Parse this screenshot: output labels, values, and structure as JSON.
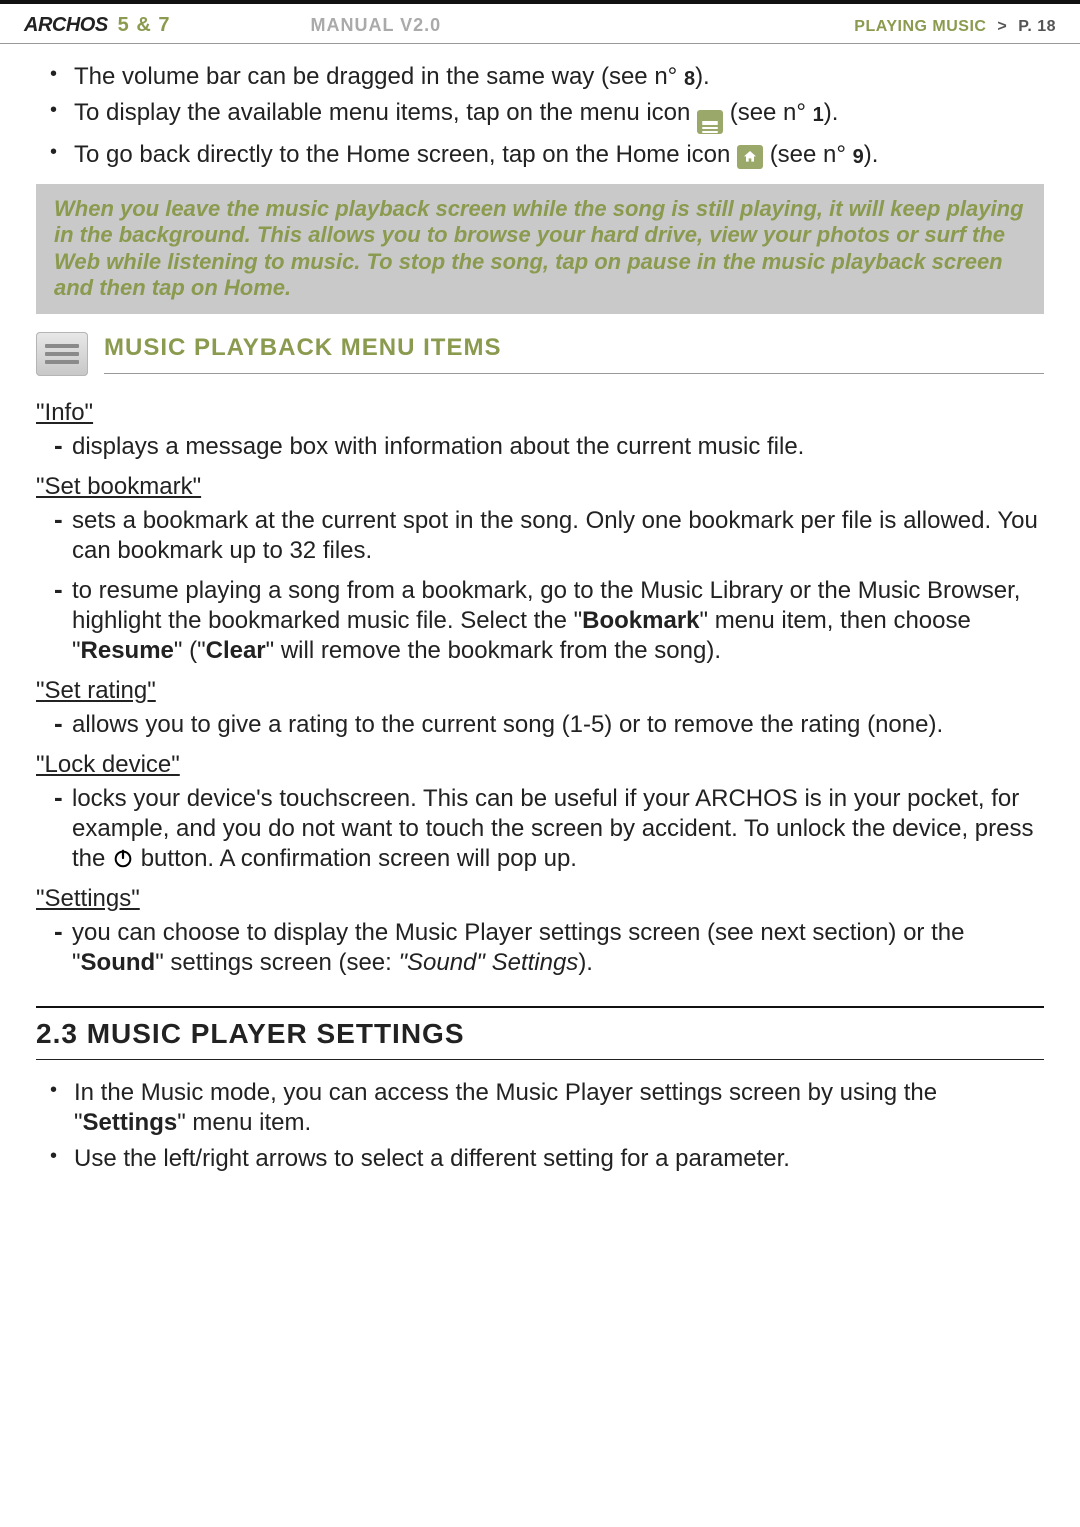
{
  "header": {
    "brand": "ARCHOS",
    "model": "5 & 7",
    "manual": "MANUAL V2.0",
    "section": "PLAYING MUSIC",
    "gt": ">",
    "page": "P. 18"
  },
  "intro_bullets": [
    {
      "pre": "The volume bar can be dragged in the same way (see n° ",
      "ref": "8",
      "post": ")."
    },
    {
      "pre": "To display the available menu items, tap on the menu icon ",
      "icon": "menu",
      "mid": " (see n° ",
      "ref": "1",
      "post": ")."
    },
    {
      "pre": "To go back directly to the Home screen, tap on the Home icon ",
      "icon": "home",
      "mid": " (see n° ",
      "ref": "9",
      "post": ")."
    }
  ],
  "note": "When you leave the music playback screen while the song is still playing, it will keep playing in the background. This allows you to browse your hard drive, view your photos or surf the Web while listening to music. To stop the song, tap on pause in the music playback screen and then tap on Home.",
  "section_menu_title": "MUSIC PLAYBACK MENU ITEMS",
  "menu_items": {
    "info": {
      "title": "\"Info\"",
      "lines": [
        {
          "text": "displays a message box with information about the current music file."
        }
      ]
    },
    "set_bookmark": {
      "title": "\"Set bookmark\"",
      "lines": [
        {
          "text": "sets a bookmark at the current spot in the song. Only one bookmark per file is allowed. You can bookmark up to 32 files."
        },
        {
          "pre": "to resume playing a song from a bookmark, go to the Music Library or the Music Browser, highlight the bookmarked music file. Select the \"",
          "b1": "Bookmark",
          "mid1": "\" menu item, then choose \"",
          "b2": "Resume",
          "mid2": "\" (\"",
          "b3": "Clear",
          "post": "\" will remove the bookmark from the song)."
        }
      ]
    },
    "set_rating": {
      "title": "\"Set rating\"",
      "lines": [
        {
          "text": "allows you to give a rating to the current song (1-5) or to remove the rating (none)."
        }
      ]
    },
    "lock_device": {
      "title": "\"Lock device\"",
      "lines": [
        {
          "pre": "locks your device's touchscreen. This can be useful if your ARCHOS is in your pocket, for example, and you do not want to touch the screen by accident. To unlock the device, press the ",
          "icon": "power",
          "post": " button. A confirmation screen will pop up."
        }
      ]
    },
    "settings": {
      "title": "\"Settings\"",
      "lines": [
        {
          "pre": "you can choose to display the Music Player settings screen (see next section) or the \"",
          "b1": "Sound",
          "mid1": "\" settings screen (see: ",
          "i1": "\"Sound\" Settings",
          "post": ")."
        }
      ]
    }
  },
  "h2": "2.3 MUSIC PLAYER SETTINGS",
  "settings_bullets": [
    {
      "pre": "In the Music mode, you can access the Music Player settings screen by using the \"",
      "b1": "Settings",
      "post": "\" menu item."
    },
    {
      "text": "Use the left/right arrows to select a different setting for a parameter."
    }
  ]
}
